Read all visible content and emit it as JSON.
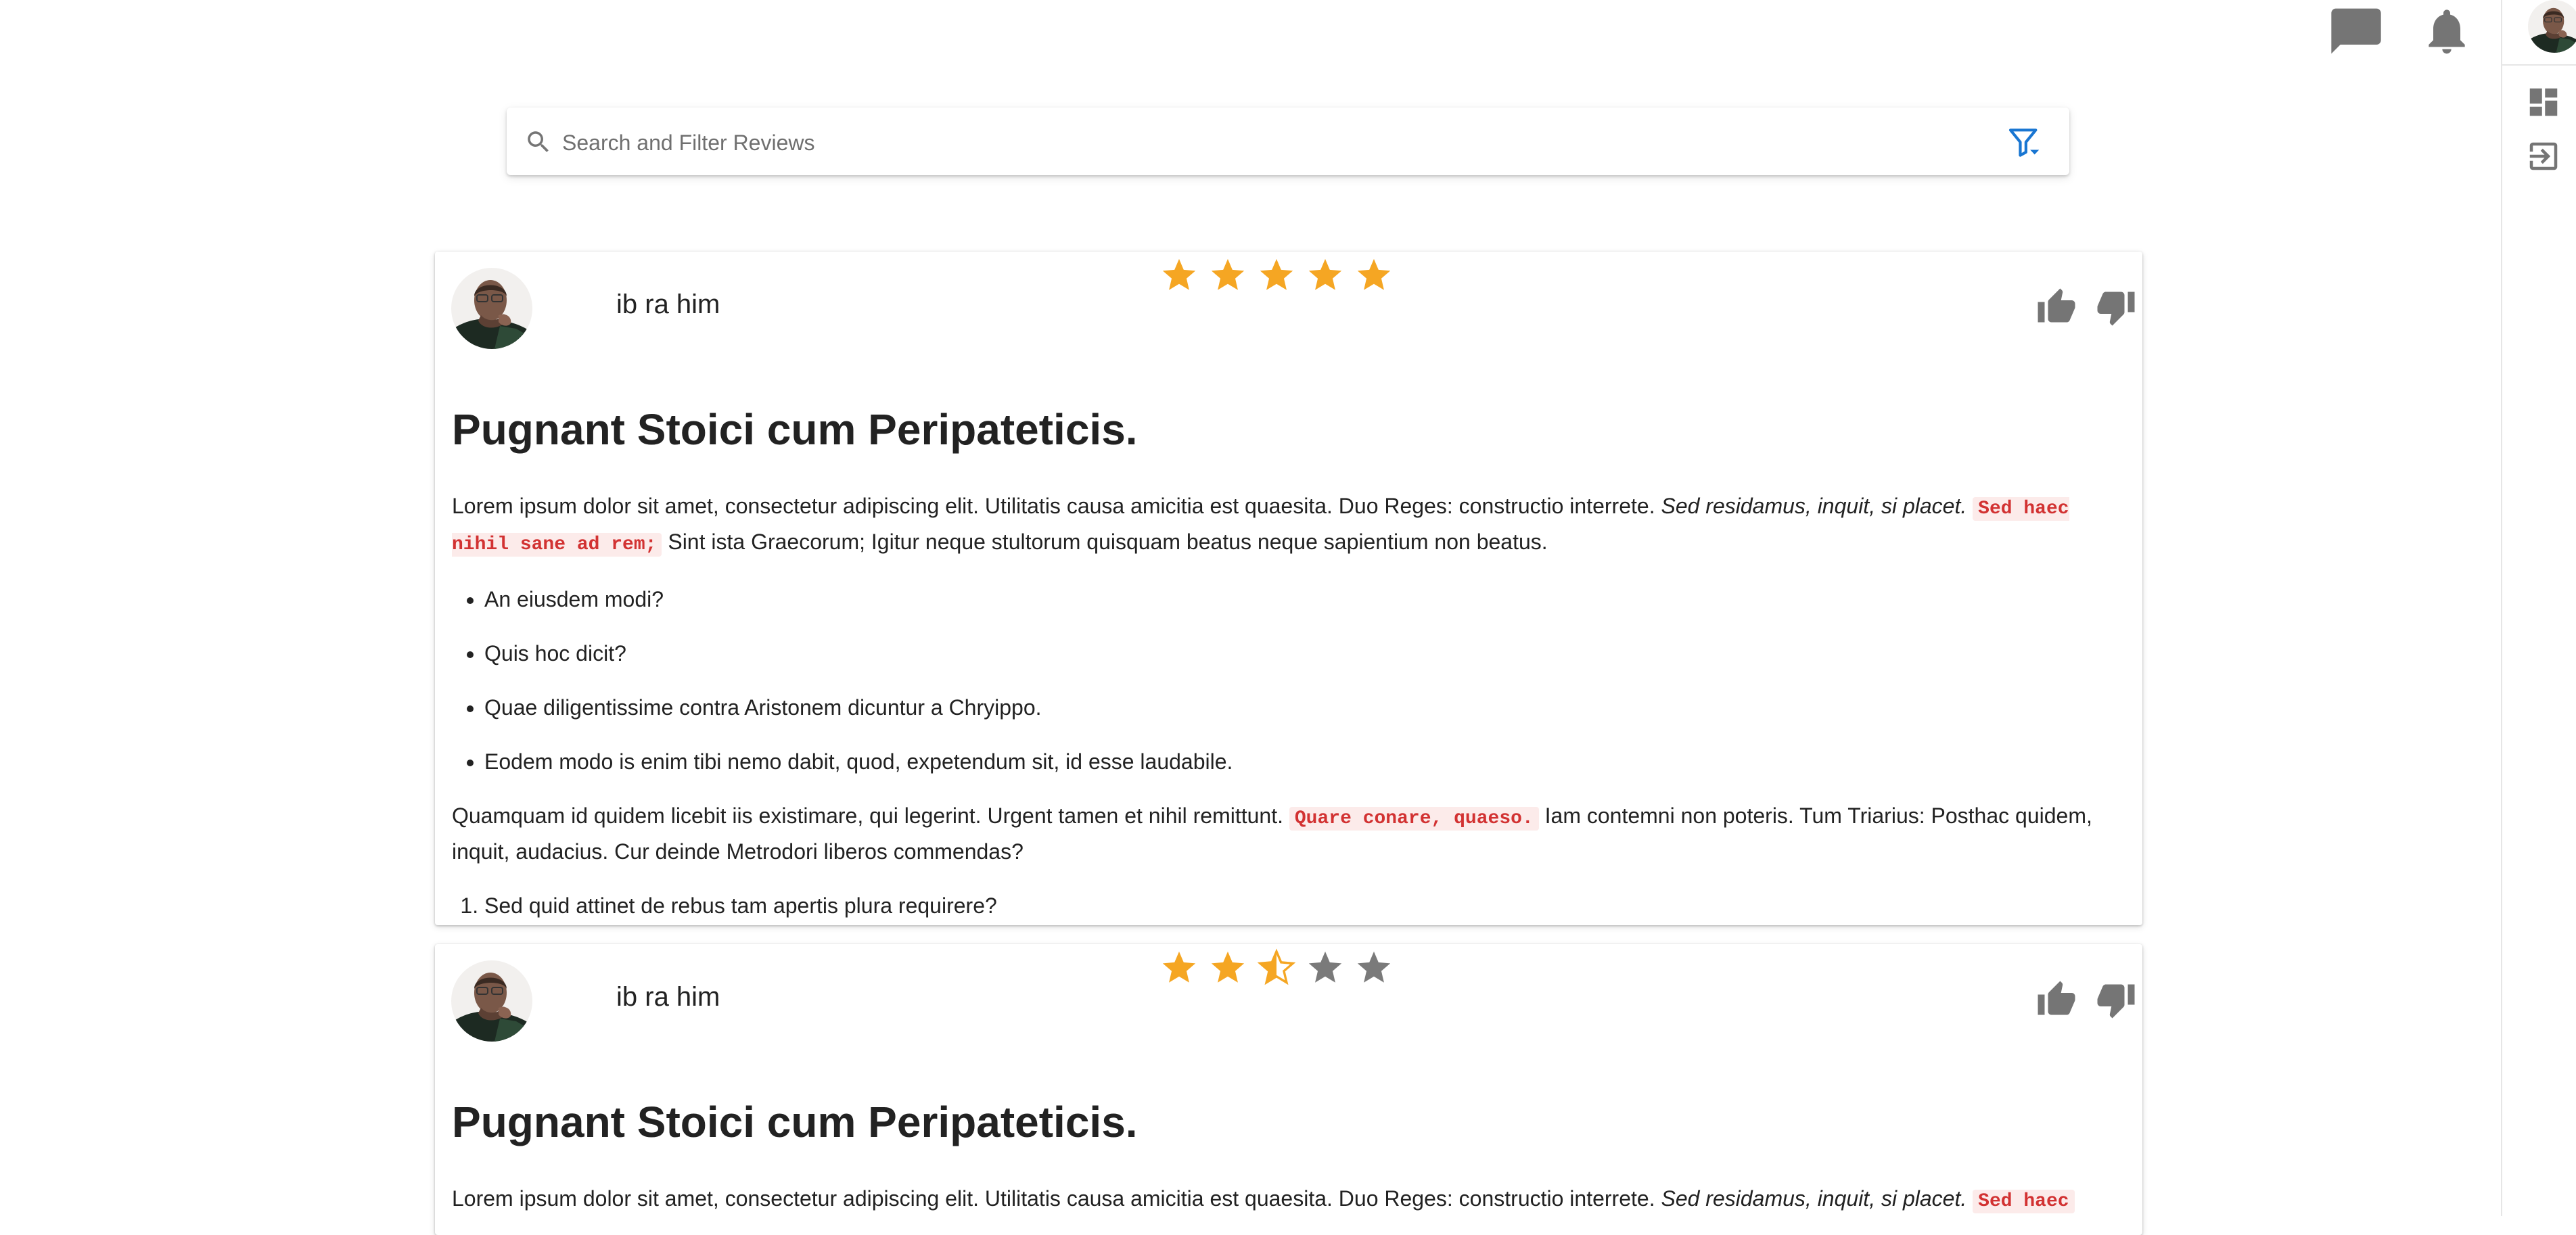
{
  "search": {
    "placeholder": "Search and Filter Reviews",
    "value": ""
  },
  "reviews": [
    {
      "reviewer": "ib ra him",
      "rating": 5,
      "title": "Pugnant Stoici cum Peripateticis.",
      "p1": {
        "text": "Lorem ipsum dolor sit amet, consectetur adipiscing elit. Utilitatis causa amicitia est quaesita. Duo Reges: constructio interrete. ",
        "em": "Sed residamus, inquit, si placet.",
        "code": "Sed haec nihil sane ad rem;",
        "after": "Sint ista Graecorum; Igitur neque stultorum quisquam beatus neque sapientium non beatus."
      },
      "bullets": [
        "An eiusdem modi?",
        "Quis hoc dicit?",
        "Quae diligentissime contra Aristonem dicuntur a Chryippo.",
        "Eodem modo is enim tibi nemo dabit, quod, expetendum sit, id esse laudabile."
      ],
      "p2": {
        "text": "Quamquam id quidem licebit iis existimare, qui legerint. Urgent tamen et nihil remittunt.",
        "code": "Quare conare, quaeso.",
        "after": "Iam contemni non poteris. Tum Triarius: Posthac quidem, inquit, audacius. Cur deinde Metrodori liberos commendas?"
      },
      "numbered": [
        "Sed quid attinet de rebus tam apertis plura requirere?"
      ]
    },
    {
      "reviewer": "ib ra him",
      "rating": 2.5,
      "title": "Pugnant Stoici cum Peripateticis.",
      "p1": {
        "text": "Lorem ipsum dolor sit amet, consectetur adipiscing elit. Utilitatis causa amicitia est quaesita. Duo Reges: constructio interrete. ",
        "em": "Sed residamus, inquit, si placet.",
        "code": "Sed haec"
      }
    }
  ],
  "colors": {
    "star_filled": "#f5a623",
    "star_empty": "#7a7a7a",
    "icon_gray": "#757575",
    "accent_blue": "#1976d2",
    "code_red": "#d23232",
    "code_bg": "#fcebea"
  },
  "icons": {
    "top_bar": [
      "chat-icon",
      "bell-icon"
    ],
    "right_rail": [
      "dashboard-icon",
      "logout-icon"
    ],
    "search": [
      "search-icon",
      "filter-icon"
    ],
    "vote": [
      "thumb-up-icon",
      "thumb-down-icon"
    ]
  }
}
